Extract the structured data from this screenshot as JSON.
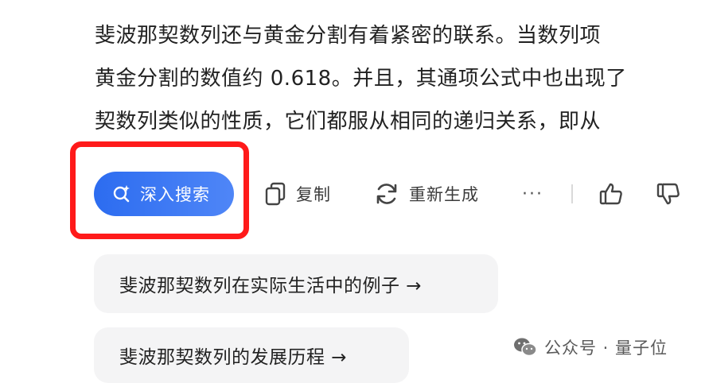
{
  "answer": {
    "lines": [
      "斐波那契数列还与黄金分割有着紧密的联系。当数列项",
      "黄金分割的数值约 0.618。并且，其通项公式中也出现了",
      "契数列类似的性质，它们都服从相同的递归关系，即从"
    ]
  },
  "actions": {
    "deep_search_label": "深入搜索",
    "copy_label": "复制",
    "regenerate_label": "重新生成",
    "more_label": "···"
  },
  "suggestions": [
    {
      "label": "斐波那契数列在实际生活中的例子 →"
    },
    {
      "label": "斐波那契数列的发展历程 →"
    }
  ],
  "watermark": {
    "text": "公众号 · 量子位"
  },
  "colors": {
    "accent": "#2c6cf0",
    "highlight": "#ff1a1a",
    "suggestion_bg": "#f4f4f5"
  },
  "icons": {
    "deep_search": "search-sparkle-icon",
    "copy": "copy-icon",
    "regenerate": "refresh-icon",
    "like": "thumbs-up-icon",
    "dislike": "thumbs-down-icon",
    "watermark": "wechat-icon"
  }
}
